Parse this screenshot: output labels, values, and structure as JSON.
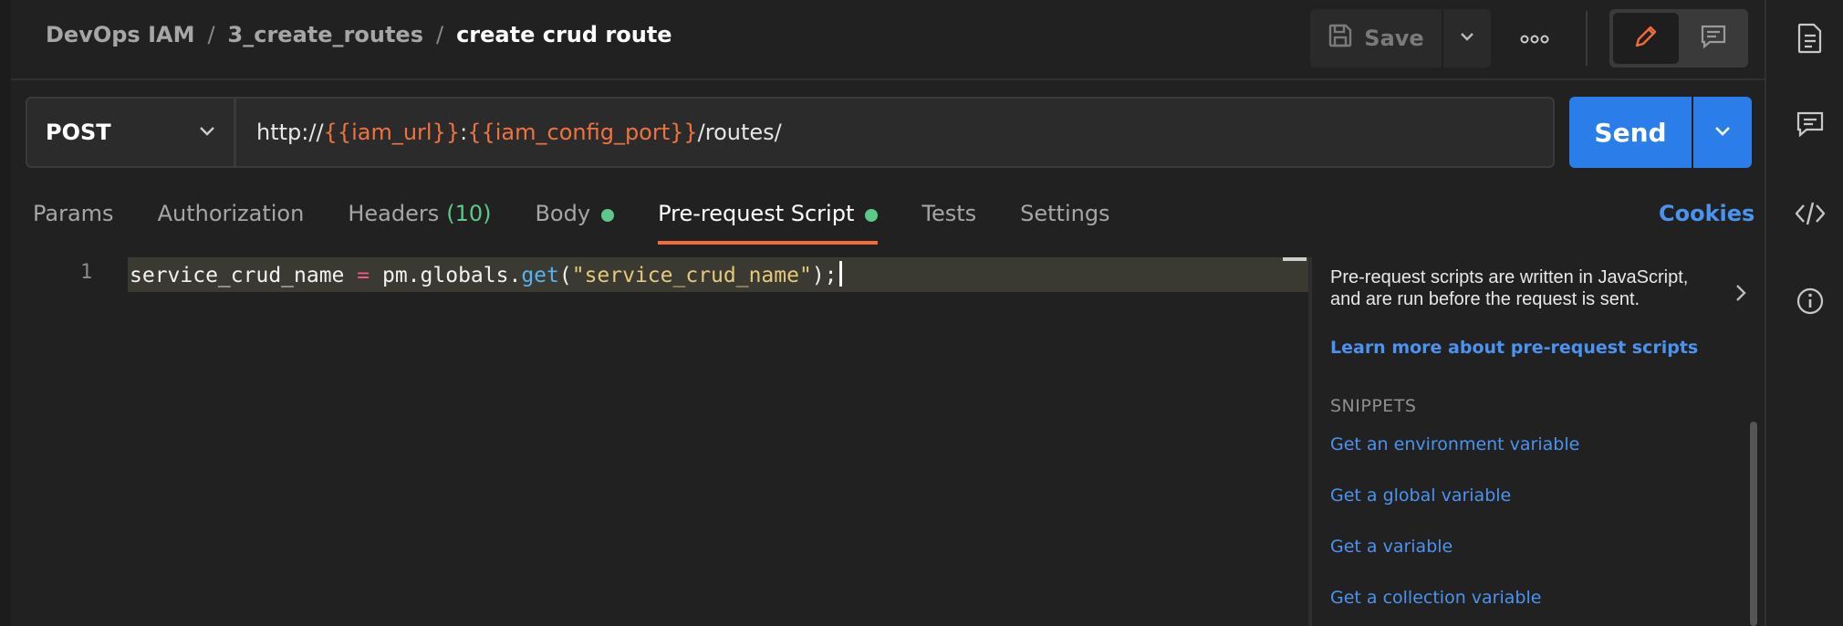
{
  "breadcrumb": {
    "items": [
      "DevOps IAM",
      "3_create_routes",
      "create crud route"
    ],
    "separator": "/"
  },
  "toolbar": {
    "save_label": "Save"
  },
  "request": {
    "method": "POST",
    "url_prefix": "http://",
    "var1": "{{iam_url}}",
    "colon": ":",
    "var2": "{{iam_config_port}}",
    "url_suffix": "/routes/",
    "send_label": "Send"
  },
  "tabs": {
    "params": "Params",
    "authorization": "Authorization",
    "headers": "Headers",
    "headers_count": "(10)",
    "body": "Body",
    "prerequest": "Pre-request Script",
    "tests": "Tests",
    "settings": "Settings",
    "active": "Pre-request Script"
  },
  "cookies_label": "Cookies",
  "editor": {
    "line_number": "1",
    "code": {
      "var": "service_crud_name",
      "op": "=",
      "obj": "pm.globals.",
      "fn": "get",
      "open": "(",
      "str": "\"service_crud_name\"",
      "close": ");"
    }
  },
  "help": {
    "description": "Pre-request scripts are written in JavaScript, and are run before the request is sent.",
    "learn_more": "Learn more about pre-request scripts",
    "snippets_heading": "SNIPPETS",
    "snippets": [
      "Get an environment variable",
      "Get a global variable",
      "Get a variable",
      "Get a collection variable"
    ]
  },
  "colors": {
    "accent_orange": "#f26b3a",
    "send_blue": "#2b7de9",
    "link_blue": "#4b93f0",
    "status_green": "#5cc98a",
    "variable_orange": "#f0733f"
  },
  "icons": {
    "save": "floppy-disk-icon",
    "more": "ellipsis-icon",
    "edit": "pencil-icon",
    "comment": "comment-icon",
    "side": [
      "document-icon",
      "comments-icon",
      "code-icon",
      "info-icon"
    ]
  }
}
